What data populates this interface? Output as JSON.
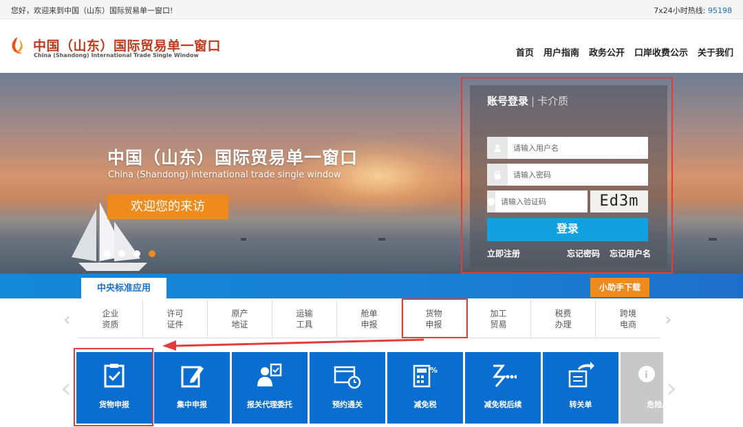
{
  "topbar": {
    "welcome": "您好，欢迎来到中国（山东）国际贸易单一窗口!",
    "hotline_label": "7x24小时热线: ",
    "hotline_number": "95198"
  },
  "header": {
    "title_cn": "中国（山东）国际贸易单一窗口",
    "title_en": "China (Shandong) International Trade Single Window",
    "nav": [
      "首页",
      "用户指南",
      "政务公开",
      "口岸收费公示",
      "关于我们"
    ]
  },
  "hero": {
    "title_cn": "中国（山东）国际贸易单一窗口",
    "title_en": "China (Shandong) international trade single window",
    "welcome_button": "欢迎您的来访",
    "carousel_active_index": 4
  },
  "login": {
    "tab_active": "账号登录",
    "tab_separator": "|",
    "tab_inactive": "卡介质",
    "username_placeholder": "请输入用户名",
    "password_placeholder": "请输入密码",
    "captcha_placeholder": "请输入验证码",
    "captcha_text": "Ed3m",
    "login_button": "登录",
    "register_link": "立即注册",
    "forgot_password_link": "忘记密码",
    "forgot_username_link": "忘记用户名"
  },
  "band": {
    "tab_label": "中央标准应用",
    "helper_button": "小助手下载"
  },
  "categories": [
    {
      "line1": "企业",
      "line2": "资质"
    },
    {
      "line1": "许可",
      "line2": "证件"
    },
    {
      "line1": "原产",
      "line2": "地证"
    },
    {
      "line1": "运输",
      "line2": "工具"
    },
    {
      "line1": "舱单",
      "line2": "申报"
    },
    {
      "line1": "货物",
      "line2": "申报"
    },
    {
      "line1": "加工",
      "line2": "贸易"
    },
    {
      "line1": "税费",
      "line2": "办理"
    },
    {
      "line1": "跨境",
      "line2": "电商"
    }
  ],
  "tiles": [
    {
      "label": "货物申报",
      "icon": "clipboard-check-icon"
    },
    {
      "label": "集中申报",
      "icon": "edit-form-icon"
    },
    {
      "label": "报关代理委托",
      "icon": "agent-delegate-icon"
    },
    {
      "label": "预约通关",
      "icon": "schedule-clock-icon"
    },
    {
      "label": "减免税",
      "icon": "calculator-percent-icon"
    },
    {
      "label": "减免税后续",
      "icon": "tax-followup-icon"
    },
    {
      "label": "转关单",
      "icon": "transfer-form-icon"
    },
    {
      "label": "危险品",
      "icon": "info-person-icon"
    }
  ],
  "colors": {
    "brand_blue": "#0a6ed1",
    "accent_orange": "#ef8a1d",
    "highlight_red": "#e23c3c",
    "login_blue": "#11a0e0"
  }
}
